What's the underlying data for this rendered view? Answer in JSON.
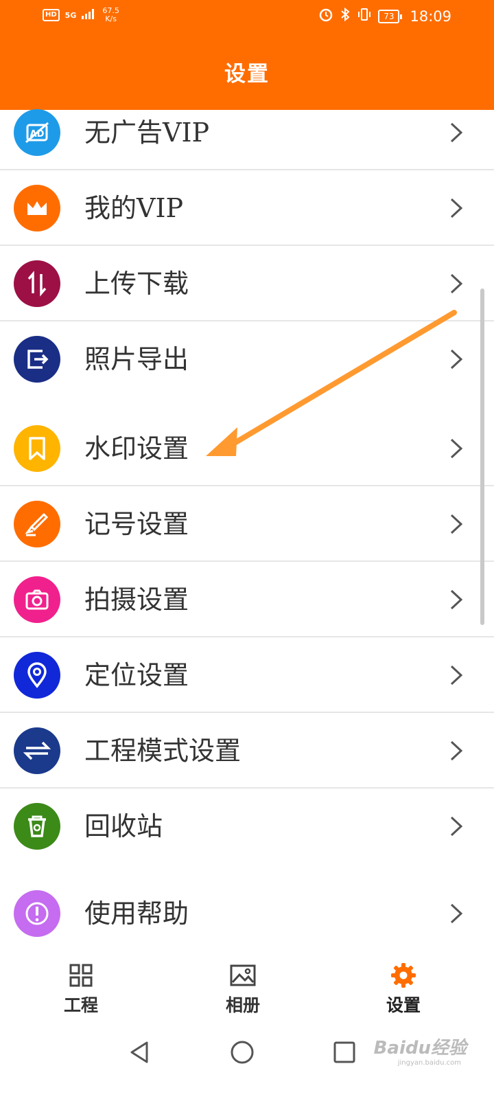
{
  "status_bar": {
    "hd": "HD",
    "signal": "5G",
    "net_speed_value": "67.5",
    "net_speed_unit": "K/s",
    "battery": "73",
    "time": "18:09"
  },
  "header": {
    "title": "设置"
  },
  "settings": [
    {
      "label": "无广告VIP",
      "icon": "no-ads-icon",
      "color": "#1e9be8"
    },
    {
      "label": "我的VIP",
      "icon": "crown-icon",
      "color": "#ff6d00"
    },
    {
      "label": "上传下载",
      "icon": "upload-download-icon",
      "color": "#9c1046"
    },
    {
      "label": "照片导出",
      "icon": "export-icon",
      "color": "#1a2e86"
    },
    {
      "label": "水印设置",
      "icon": "watermark-bookmark-icon",
      "color": "#ffb400"
    },
    {
      "label": "记号设置",
      "icon": "marker-icon",
      "color": "#ff6d00"
    },
    {
      "label": "拍摄设置",
      "icon": "camera-icon",
      "color": "#f0218d"
    },
    {
      "label": "定位设置",
      "icon": "location-pin-icon",
      "color": "#1128d8"
    },
    {
      "label": "工程模式设置",
      "icon": "engineering-mode-icon",
      "color": "#1b3a8c"
    },
    {
      "label": "回收站",
      "icon": "recycle-bin-icon",
      "color": "#3c8a18"
    },
    {
      "label": "使用帮助",
      "icon": "help-exclamation-icon",
      "color": "#c56cf0"
    }
  ],
  "bottom_nav": [
    {
      "label": "工程",
      "icon": "grid-icon"
    },
    {
      "label": "相册",
      "icon": "album-icon"
    },
    {
      "label": "设置",
      "icon": "gear-icon",
      "active": true,
      "color": "#ff6d00"
    }
  ],
  "watermark": {
    "text": "Baidu经验",
    "sub": "jingyan.baidu.com"
  },
  "annotation_color": "#ff9a30"
}
